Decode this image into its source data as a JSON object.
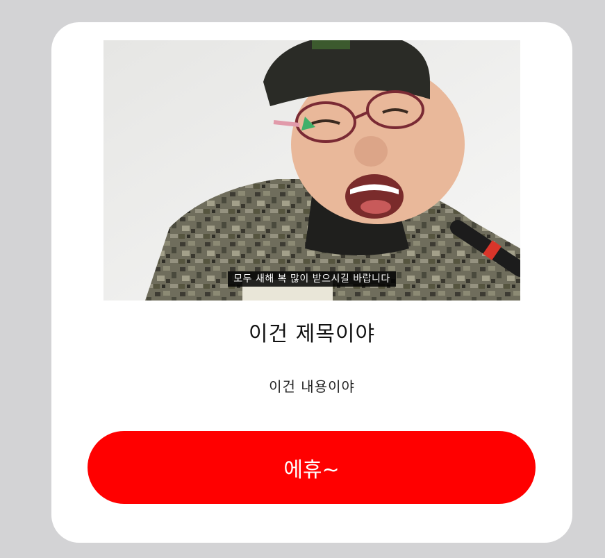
{
  "card": {
    "image": {
      "caption": "모두 새해 복 많이 받으시길 바랍니다"
    },
    "title": "이건 제목이야",
    "content": "이건 내용이야",
    "button_label": "에휴~"
  },
  "colors": {
    "page_background": "#d3d3d5",
    "card_background": "#ffffff",
    "button_background": "#ff0000",
    "button_text": "#ffffff"
  }
}
